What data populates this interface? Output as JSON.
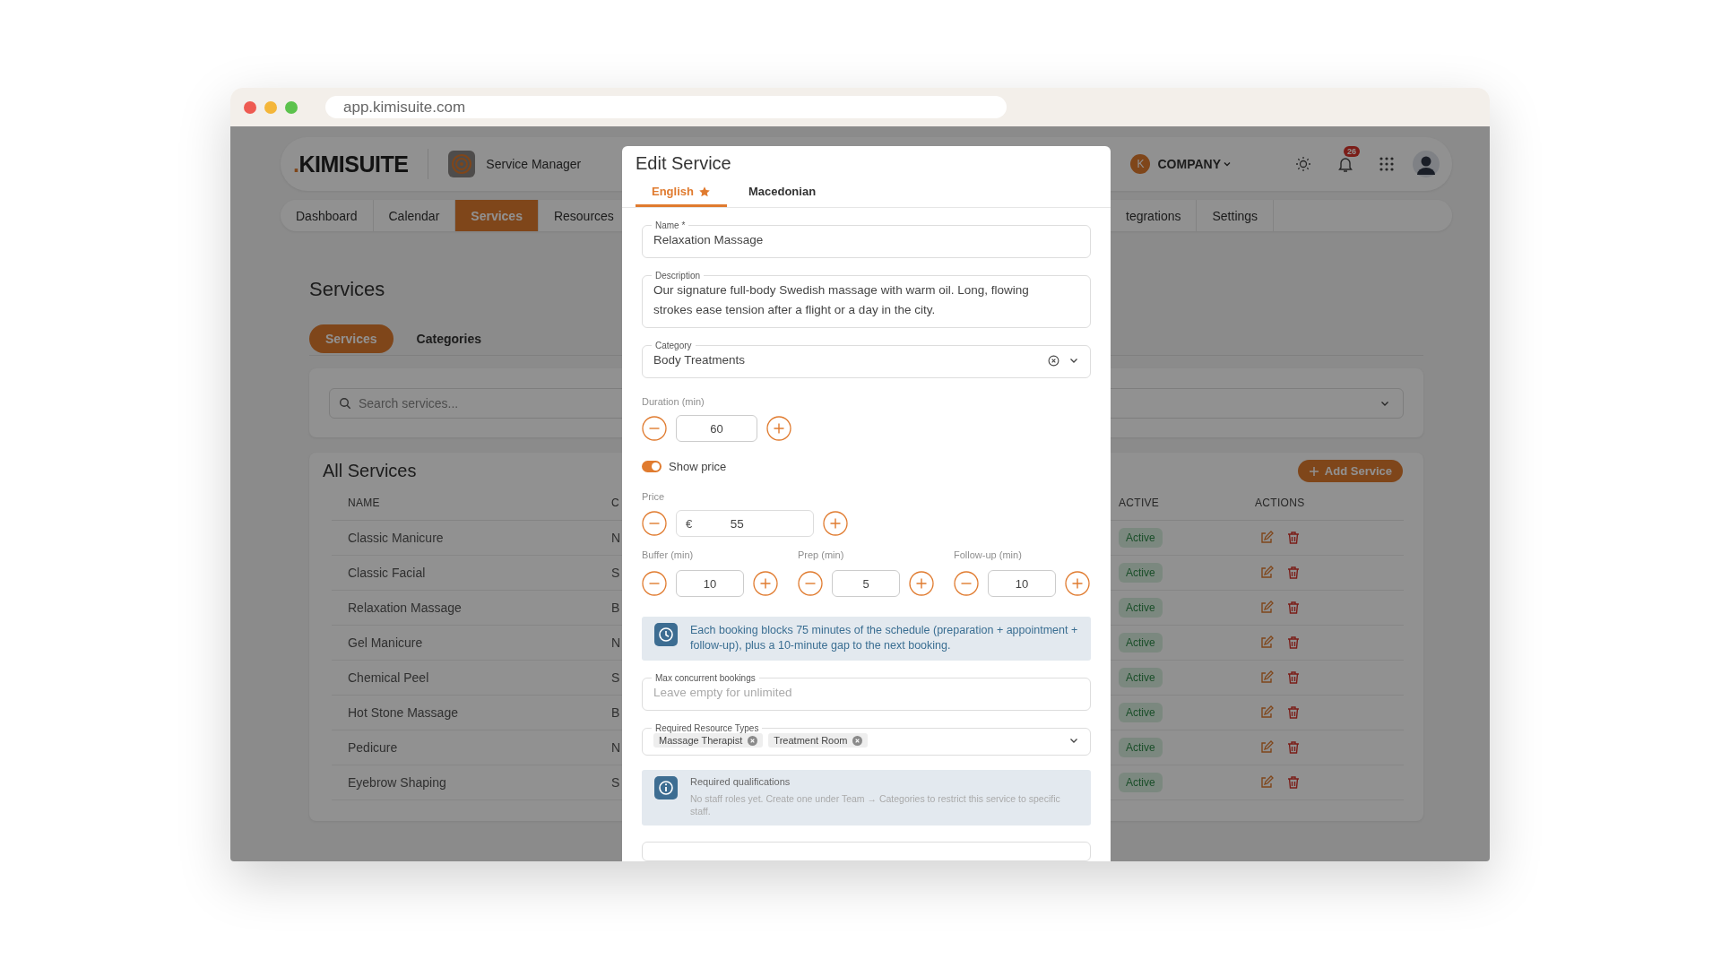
{
  "browser": {
    "url": "app.kimisuite.com"
  },
  "header": {
    "logo": ".KIMISUITE",
    "app_name": "Service Manager",
    "company_initial": "K",
    "company": "COMPANY",
    "notifications": "26"
  },
  "nav": [
    {
      "label": "Dashboard",
      "selected": false
    },
    {
      "label": "Calendar",
      "selected": false
    },
    {
      "label": "Services",
      "selected": true
    },
    {
      "label": "Resources",
      "selected": false
    },
    {
      "label": "tegrations",
      "selected": false
    },
    {
      "label": "Settings",
      "selected": false
    }
  ],
  "page": {
    "title": "Services",
    "tabs": [
      {
        "label": "Services",
        "selected": true
      },
      {
        "label": "Categories",
        "selected": false
      }
    ],
    "search": {
      "placeholder": "Search services..."
    }
  },
  "table": {
    "title": "All Services",
    "add_button": "Add Service",
    "columns": [
      "NAME",
      "C",
      "ACTIVE",
      "ACTIONS"
    ],
    "rows": [
      {
        "name": "Classic Manicure",
        "category": "N",
        "status": "Active",
        "active": true
      },
      {
        "name": "Classic Facial",
        "category": "S",
        "status": "Active",
        "active": true
      },
      {
        "name": "Relaxation Massage",
        "category": "B",
        "status": "Active",
        "active": true
      },
      {
        "name": "Gel Manicure",
        "category": "N",
        "status": "Active",
        "active": true
      },
      {
        "name": "Chemical Peel",
        "category": "S",
        "status": "Active",
        "active": true
      },
      {
        "name": "Hot Stone Massage",
        "category": "B",
        "status": "Active",
        "active": true
      },
      {
        "name": "Pedicure",
        "category": "N",
        "status": "Active",
        "active": true
      },
      {
        "name": "Eyebrow Shaping",
        "category": "S",
        "status": "Active",
        "active": true
      }
    ]
  },
  "modal": {
    "title": "Edit Service",
    "tabs": [
      {
        "label": "English",
        "selected": true,
        "default": true
      },
      {
        "label": "Macedonian",
        "selected": false,
        "default": false
      }
    ],
    "name": {
      "label": "Name *",
      "value": "Relaxation Massage"
    },
    "description": {
      "label": "Description",
      "value": "Our signature full-body Swedish massage with warm oil. Long, flowing strokes ease tension after a flight or a day in the city."
    },
    "category": {
      "label": "Category",
      "value": "Body Treatments"
    },
    "duration": {
      "label": "Duration (min)",
      "value": "60"
    },
    "show_price": {
      "label": "Show price",
      "on": true
    },
    "price": {
      "label": "Price",
      "currency": "€",
      "value": "55"
    },
    "timings": [
      {
        "label": "Buffer (min)",
        "value": "10"
      },
      {
        "label": "Prep (min)",
        "value": "5"
      },
      {
        "label": "Follow-up (min)",
        "value": "10"
      }
    ],
    "schedule_note": "Each booking blocks 75 minutes of the schedule (preparation + appointment + follow-up), plus a 10-minute gap to the next booking.",
    "max_concurrent": {
      "label": "Max concurrent bookings",
      "placeholder": "Leave empty for unlimited"
    },
    "resource_types": {
      "label": "Required Resource Types",
      "chips": [
        "Massage Therapist",
        "Treatment Room"
      ]
    },
    "qualifications": {
      "title": "Required qualifications",
      "text": "No staff roles yet. Create one under Team → Categories to restrict this service to specific staff."
    }
  }
}
